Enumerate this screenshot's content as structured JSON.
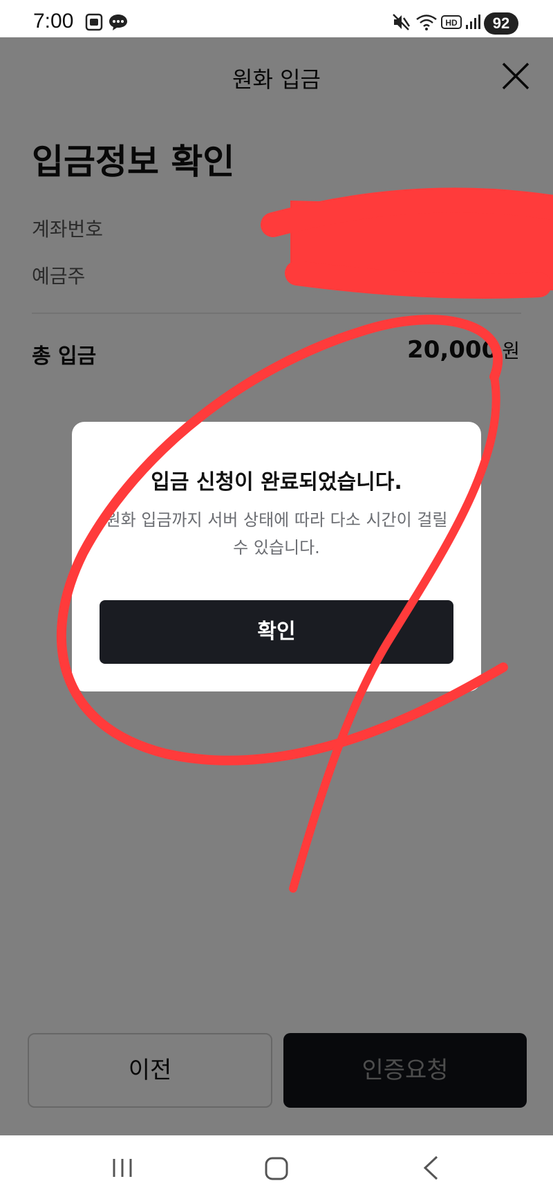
{
  "status_bar": {
    "time": "7:00",
    "battery": "92",
    "icons": [
      "screenshot-icon",
      "chat-icon",
      "mute-icon",
      "wifi-icon",
      "hd-icon",
      "signal-icon"
    ]
  },
  "header": {
    "title": "원화 입금",
    "close_icon": "close-icon"
  },
  "page": {
    "title": "입금정보 확인",
    "account_label": "계좌번호",
    "holder_label": "예금주",
    "total_label": "총 입금",
    "total_amount": "20,000",
    "total_unit": "원"
  },
  "dialog": {
    "title": "입금 신청이 완료되었습니다.",
    "message": "원화 입금까지 서버 상태에 따라 다소 시간이 걸릴 수 있습니다.",
    "confirm_label": "확인"
  },
  "footer": {
    "prev_label": "이전",
    "auth_label": "인증요청"
  },
  "nav_bar": {
    "icons": [
      "recent-apps-icon",
      "home-icon",
      "back-icon"
    ]
  },
  "colors": {
    "annotation_red": "#ff3b3b",
    "dialog_button": "#1a1c22",
    "overlay": "rgba(0,0,0,0.5)"
  }
}
